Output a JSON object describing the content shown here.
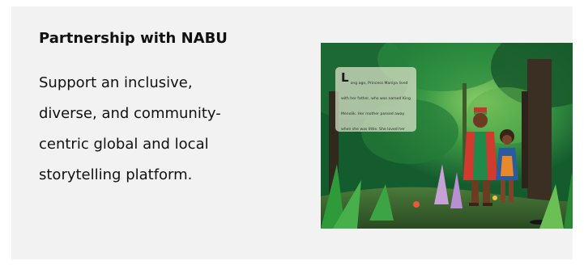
{
  "card": {
    "title": "Partnership with NABU",
    "description_lines": [
      "Support an inclusive,",
      "diverse, and community-",
      "centric global and local",
      "storytelling platform."
    ]
  },
  "illustration": {
    "drop_cap": "L",
    "story_text": "ong ago, Princess Maniya lived with her father, who was named King Menelik. Her mother passed away when she was little. She loved her father, and the King loved her too. She loved to go hunting with her father."
  },
  "colors": {
    "card_background": "#f2f2f2",
    "text": "#111111",
    "jungle_green": "#1f7a3a"
  }
}
